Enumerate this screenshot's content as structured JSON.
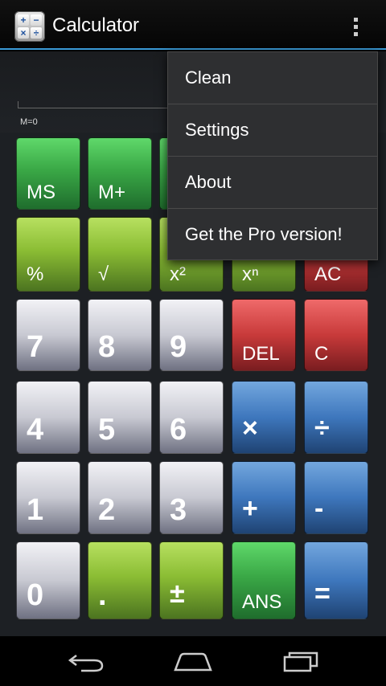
{
  "app": {
    "title": "Calculator"
  },
  "app_icon": {
    "symbols": [
      "+",
      "−",
      "×",
      "÷"
    ]
  },
  "display": {
    "memory": "M=0"
  },
  "menu": {
    "items": [
      {
        "label": "Clean"
      },
      {
        "label": "Settings"
      },
      {
        "label": "About"
      },
      {
        "label": "Get the Pro version!"
      }
    ]
  },
  "keys": {
    "row1": [
      "MS",
      "M+",
      "",
      "",
      ""
    ],
    "row2": [
      "%",
      "√",
      "x²",
      "xⁿ",
      "AC"
    ],
    "row3": [
      "7",
      "8",
      "9",
      "DEL",
      "C"
    ],
    "row4": [
      "4",
      "5",
      "6",
      "×",
      "÷"
    ],
    "row5": [
      "1",
      "2",
      "3",
      "+",
      "-"
    ],
    "row6": [
      "0",
      ".",
      "±",
      "ANS",
      "="
    ]
  },
  "nav": {
    "icons": [
      "back-icon",
      "home-icon",
      "recent-apps-icon"
    ]
  },
  "colors": {
    "accent": "#3a9ad6",
    "green_key": "#3aa846",
    "lime_key": "#8bbd34",
    "gray_key": "#c8c9d2",
    "red_key": "#c83a3a",
    "blue_key": "#3e77bd"
  }
}
